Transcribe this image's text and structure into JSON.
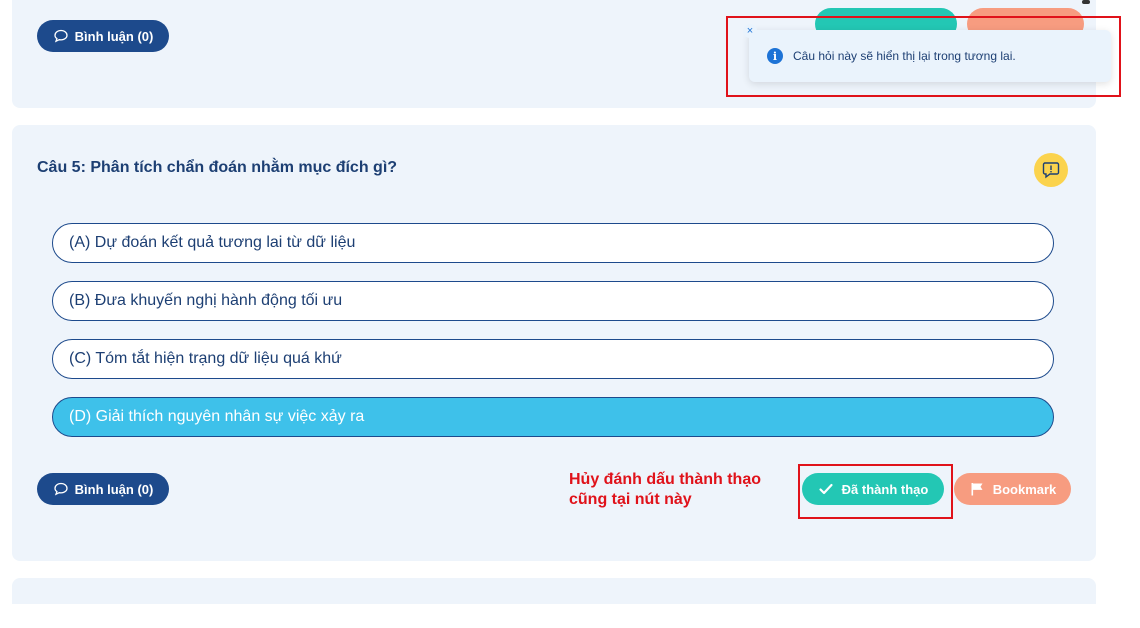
{
  "top_card": {
    "comment_label": "Bình luận (0)"
  },
  "toast": {
    "message": "Câu hỏi này sẽ hiển thị lại trong tương lai.",
    "close_glyph": "×",
    "info_glyph": "i"
  },
  "question": {
    "title": "Câu 5: Phân tích chẩn đoán nhằm mục đích gì?",
    "options": [
      {
        "label": "(A) Dự đoán kết quả tương lai từ dữ liệu",
        "selected": false
      },
      {
        "label": "(B) Đưa khuyến nghị hành động tối ưu",
        "selected": false
      },
      {
        "label": "(C) Tóm tắt hiện trạng dữ liệu quá khứ",
        "selected": false
      },
      {
        "label": "(D) Giải thích nguyên nhân sự việc xảy ra",
        "selected": true
      }
    ],
    "comment_label": "Bình luận (0)",
    "mastered_label": "Đã thành thạo",
    "bookmark_label": "Bookmark"
  },
  "annotation": {
    "line1": "Hủy đánh dấu thành thạo",
    "line2": "cũng tại nút này"
  },
  "colors": {
    "primary": "#1d4a8c",
    "selected_option": "#3ec1ea",
    "mastered": "#23c7b4",
    "bookmark": "#f79c80",
    "annotation": "#e0121a",
    "report": "#fbd34d"
  }
}
